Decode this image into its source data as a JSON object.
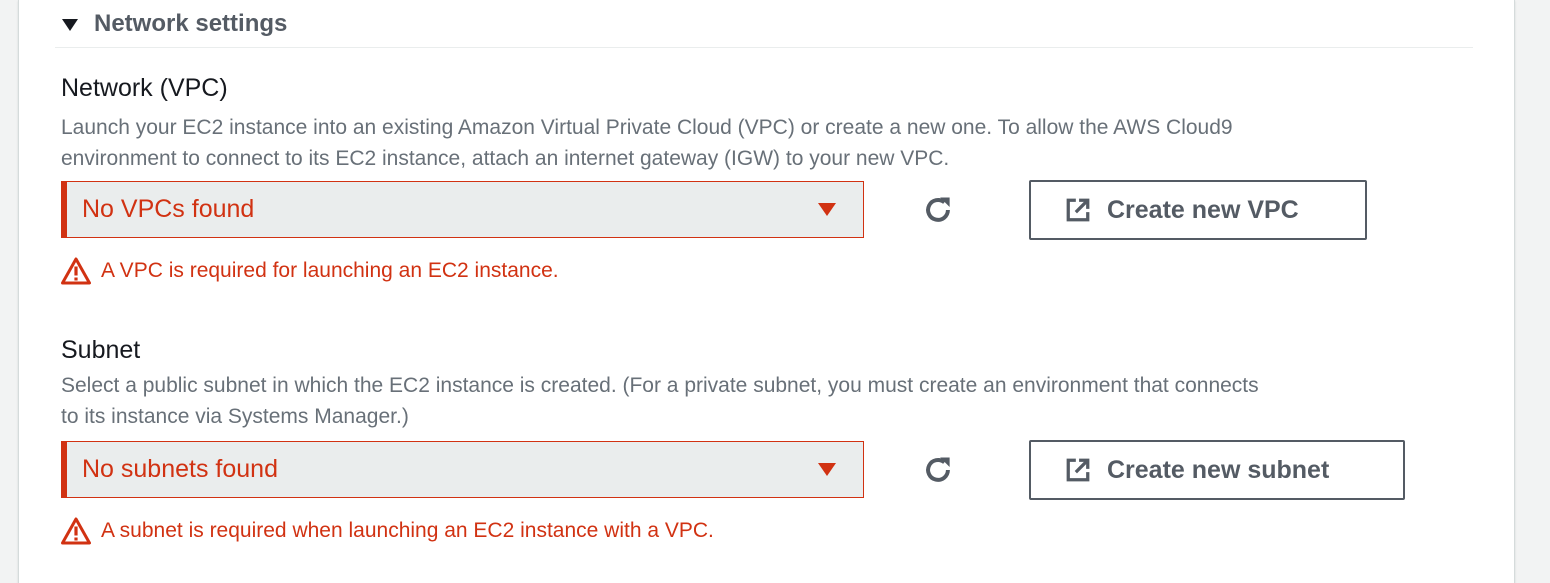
{
  "section": {
    "title": "Network settings"
  },
  "vpc": {
    "label": "Network (VPC)",
    "description_line1": "Launch your EC2 instance into an existing Amazon Virtual Private Cloud (VPC) or create a new one. To allow the AWS Cloud9",
    "description_line2": "environment to connect to its EC2 instance, attach an internet gateway (IGW) to your new VPC.",
    "select_value": "No VPCs found",
    "button_label": "Create new VPC",
    "error": "A VPC is required for launching an EC2 instance."
  },
  "subnet": {
    "label": "Subnet",
    "description_line1": "Select a public subnet in which the EC2 instance is created. (For a private subnet, you must create an environment that connects",
    "description_line2": "to its instance via Systems Manager.)",
    "select_value": "No subnets found",
    "button_label": "Create new subnet",
    "error": "A subnet is required when launching an EC2 instance with a VPC."
  },
  "icons": {
    "section_toggle": "caret-down-icon",
    "refresh": "refresh-icon",
    "external": "external-link-icon",
    "warning": "warning-icon"
  },
  "colors": {
    "error": "#d13212",
    "text_secondary": "#687078",
    "button_border": "#545b64",
    "select_bg": "#eaeded"
  }
}
